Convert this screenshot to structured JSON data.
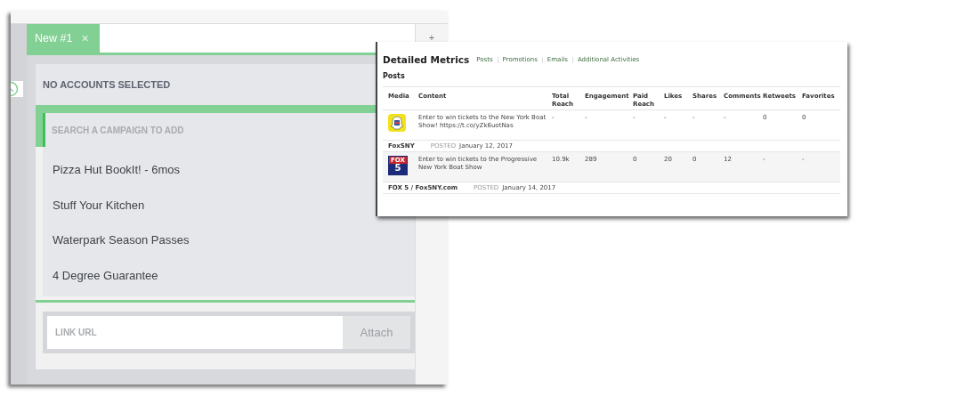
{
  "editor": {
    "tab": {
      "label": "New #1",
      "close": "×"
    },
    "add": "+",
    "header": "NO ACCOUNTS SELECTED",
    "search": {
      "placeholder": "SEARCH A CAMPAIGN TO ADD"
    },
    "campaigns": [
      "Pizza Hut BookIt! - 6mos",
      "Stuff Your Kitchen",
      "Waterpark Season Passes",
      "4 Degree Guarantee"
    ],
    "link": {
      "placeholder": "LINK URL",
      "button": "Attach"
    }
  },
  "metrics": {
    "title": "Detailed Metrics",
    "links": [
      "Posts",
      "Promotions",
      "Emails",
      "Additional Activities"
    ],
    "section": "Posts",
    "columns": [
      "Media",
      "Content",
      "Total Reach",
      "Engagement",
      "Paid Reach",
      "Likes",
      "Shares",
      "Comments",
      "Retweets",
      "Favorites"
    ],
    "posts": [
      {
        "media": {
          "kind": "ghost"
        },
        "content": "Enter to win tickets to the New York Boat Show! https://t.co/yZk6uotNas",
        "cells": [
          "-",
          "-",
          "-",
          "-",
          "-",
          "-",
          "0",
          "0"
        ],
        "account": "FoxSNY",
        "posted_label": "POSTED",
        "date": "January 12, 2017"
      },
      {
        "media": {
          "kind": "channel",
          "top": "FOX",
          "number": "5"
        },
        "content": "Enter to win tickets to the Progressive New York Boat Show",
        "cells": [
          "10.9k",
          "289",
          "0",
          "20",
          "0",
          "12",
          "-",
          "-"
        ],
        "account": "FOX 5 / Fox5NY.com",
        "posted_label": "POSTED",
        "date": "January 14, 2017"
      }
    ]
  }
}
